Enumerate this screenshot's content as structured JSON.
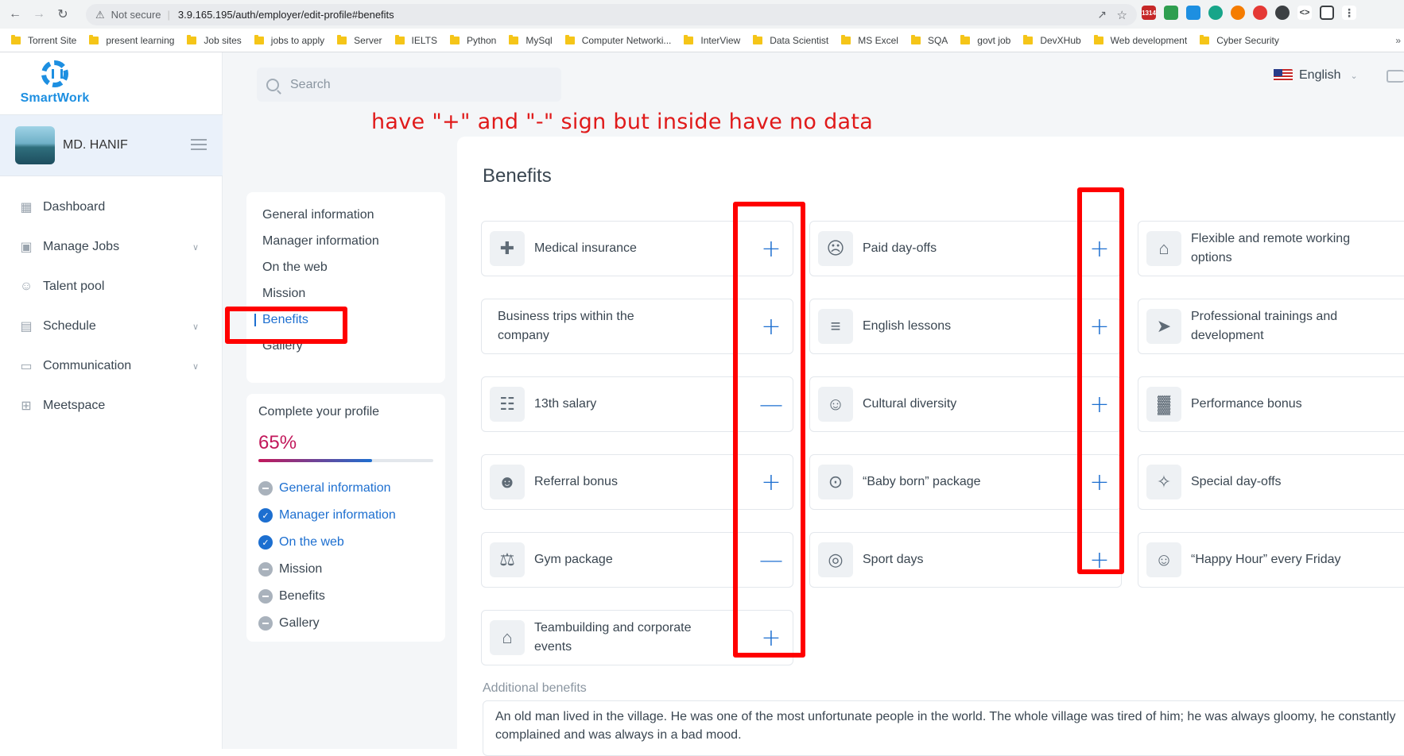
{
  "browser": {
    "not_secure": "Not secure",
    "url": "3.9.165.195/auth/employer/edit-profile#benefits",
    "bookmarks": [
      "Torrent Site",
      "present learning",
      "Job sites",
      "jobs to apply",
      "Server",
      "IELTS",
      "Python",
      "MySql",
      "Computer Networki...",
      "InterView",
      "Data Scientist",
      "MS Excel",
      "SQA",
      "govt job",
      "DevXHub",
      "Web development",
      "Cyber Security"
    ],
    "extension_badge": "1314"
  },
  "app": {
    "brand": "SmartWork",
    "user_name": "MD. HANIF",
    "menu": [
      {
        "label": "Dashboard",
        "icon": "grid-icon",
        "has_submenu": false
      },
      {
        "label": "Manage Jobs",
        "icon": "briefcase-icon",
        "has_submenu": true
      },
      {
        "label": "Talent pool",
        "icon": "user-search-icon",
        "has_submenu": false
      },
      {
        "label": "Schedule",
        "icon": "calendar-icon",
        "has_submenu": true
      },
      {
        "label": "Communication",
        "icon": "chat-icon",
        "has_submenu": true
      },
      {
        "label": "Meetspace",
        "icon": "plus-square-icon",
        "has_submenu": false
      }
    ],
    "search_placeholder": "Search",
    "language": "English",
    "annotation": "have \"+\" and \"-\" sign but inside have no data"
  },
  "profile_nav": {
    "items": [
      "General information",
      "Manager information",
      "On the web",
      "Mission",
      "Benefits",
      "Gallery"
    ],
    "active": "Benefits"
  },
  "complete_profile": {
    "title": "Complete your profile",
    "percent_text": "65%",
    "progress": 0.65,
    "items": [
      {
        "label": "General information",
        "state": "pending",
        "highlight": true
      },
      {
        "label": "Manager information",
        "state": "done",
        "highlight": true
      },
      {
        "label": "On the web",
        "state": "done",
        "highlight": true
      },
      {
        "label": "Mission",
        "state": "pending",
        "highlight": false
      },
      {
        "label": "Benefits",
        "state": "pending",
        "highlight": false
      },
      {
        "label": "Gallery",
        "state": "pending",
        "highlight": false
      }
    ]
  },
  "benefits": {
    "title": "Benefits",
    "columns": [
      [
        {
          "label": "Medical insurance",
          "icon": "shield-plus-icon",
          "toggle": "+"
        },
        {
          "label": "Business trips within the company",
          "icon": "",
          "toggle": "+"
        },
        {
          "label": "13th salary",
          "icon": "salary-icon",
          "toggle": "—"
        },
        {
          "label": "Referral bonus",
          "icon": "users-icon",
          "toggle": "+"
        },
        {
          "label": "Gym package",
          "icon": "dumbbell-icon",
          "toggle": "—"
        },
        {
          "label": "Teambuilding and corporate events",
          "icon": "tent-icon",
          "toggle": "+"
        }
      ],
      [
        {
          "label": "Paid day-offs",
          "icon": "sad-face-icon",
          "toggle": "+"
        },
        {
          "label": "English lessons",
          "icon": "book-icon",
          "toggle": "+"
        },
        {
          "label": "Cultural diversity",
          "icon": "masks-icon",
          "toggle": "+"
        },
        {
          "label": "“Baby born” package",
          "icon": "stroller-icon",
          "toggle": "+"
        },
        {
          "label": "Sport days",
          "icon": "ball-icon",
          "toggle": "+"
        }
      ],
      [
        {
          "label": "Flexible and remote working options",
          "icon": "house-icon",
          "toggle": ""
        },
        {
          "label": "Professional trainings and development",
          "icon": "rocket-icon",
          "toggle": ""
        },
        {
          "label": "Performance bonus",
          "icon": "chart-icon",
          "toggle": ""
        },
        {
          "label": "Special day-offs",
          "icon": "party-icon",
          "toggle": ""
        },
        {
          "label": "“Happy Hour” every Friday",
          "icon": "smile-icon",
          "toggle": ""
        }
      ]
    ],
    "additional_label": "Additional benefits",
    "additional_text": "An old man lived in the village. He was one of the most unfortunate people in the world. The whole village was tired of him; he was always gloomy, he constantly complained and was always in a bad mood."
  }
}
